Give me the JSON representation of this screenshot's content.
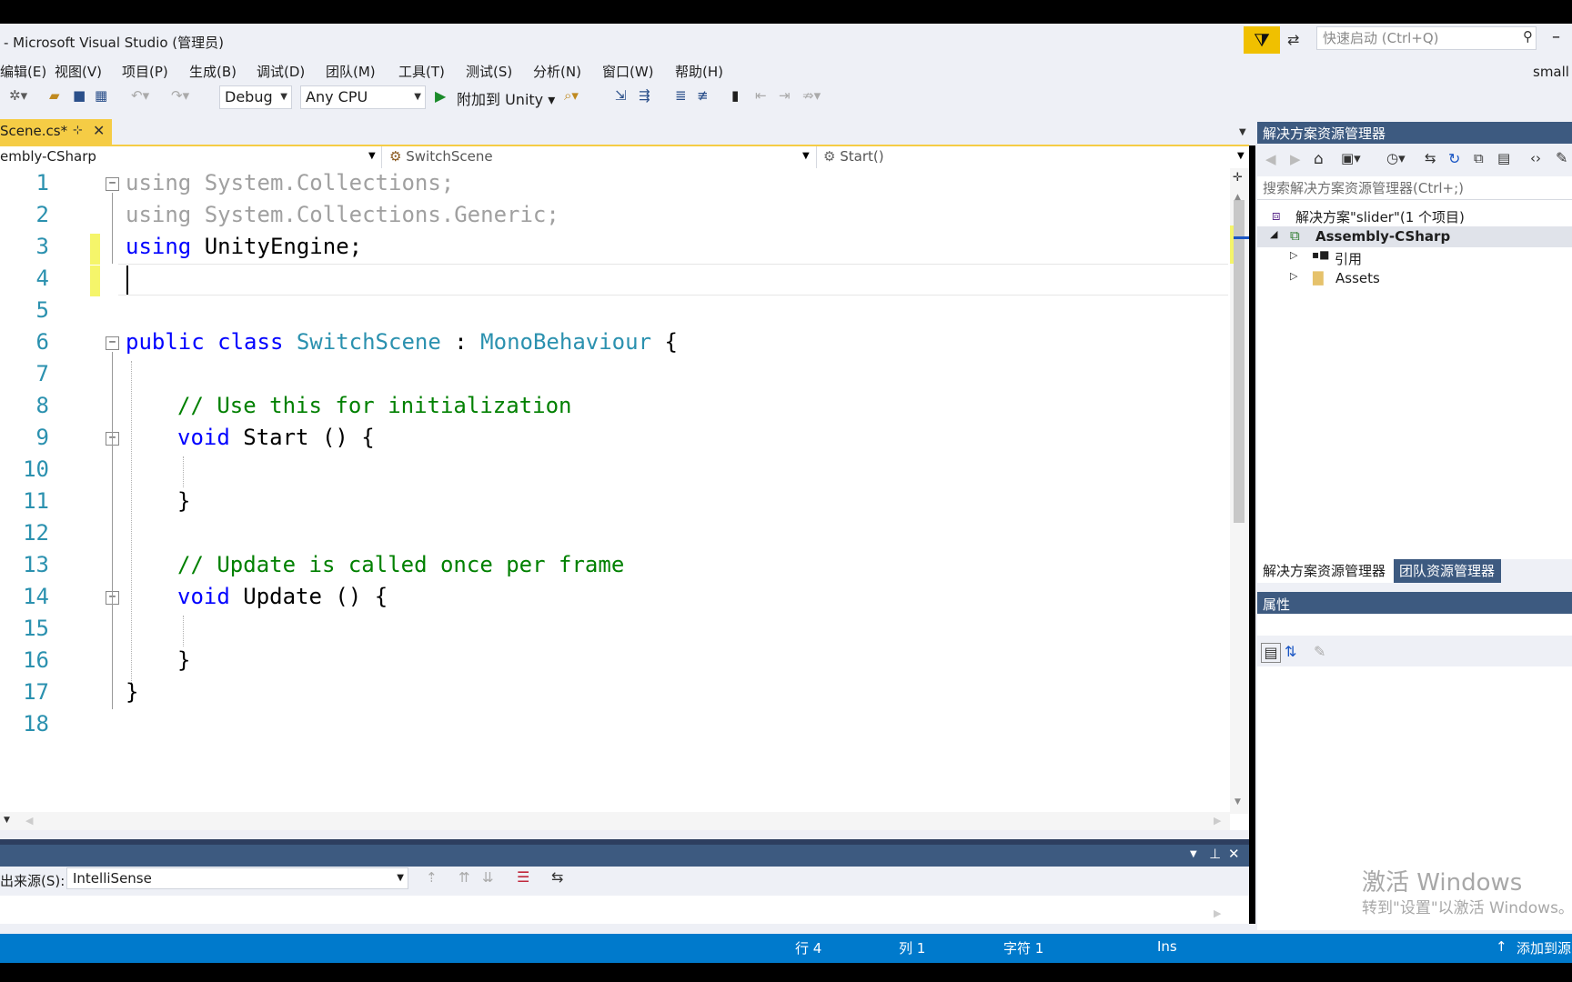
{
  "window": {
    "title": "- Microsoft Visual Studio (管理员)",
    "quick_launch_placeholder": "快速启动 (Ctrl+Q)",
    "user": "small"
  },
  "menu": [
    "编辑(E)",
    "视图(V)",
    "项目(P)",
    "生成(B)",
    "调试(D)",
    "团队(M)",
    "工具(T)",
    "测试(S)",
    "分析(N)",
    "窗口(W)",
    "帮助(H)"
  ],
  "toolbar": {
    "config": "Debug",
    "platform": "Any CPU",
    "attach": "附加到 Unity"
  },
  "tab": {
    "name": "Scene.cs*"
  },
  "nav": {
    "project": "embly-CSharp",
    "class": "SwitchScene",
    "member": "Start()"
  },
  "editor": {
    "line_numbers": [
      "1",
      "2",
      "3",
      "4",
      "5",
      "6",
      "7",
      "8",
      "9",
      "10",
      "11",
      "12",
      "13",
      "14",
      "15",
      "16",
      "17",
      "18"
    ],
    "l1_kw": "using",
    "l1_rest": " System.Collections;",
    "l2_kw": "using",
    "l2_rest": " System.Collections.Generic;",
    "l3_kw": "using",
    "l3_rest": " UnityEngine;",
    "l6_kw1": "public",
    "l6_kw2": " class ",
    "l6_type1": "SwitchScene",
    "l6_colon": " : ",
    "l6_type2": "MonoBehaviour",
    "l6_brace": " {",
    "l8_comment": "// Use this for initialization",
    "l9_kw": "void",
    "l9_rest": " Start () {",
    "l11": "}",
    "l13_comment": "// Update is called once per frame",
    "l14_kw": "void",
    "l14_rest": " Update () {",
    "l16": "}",
    "l17": "}"
  },
  "output": {
    "source_label": "出来源(S):",
    "source_value": "IntelliSense"
  },
  "status": {
    "row": "行 4",
    "col": "列 1",
    "char": "字符 1",
    "mode": "Ins",
    "source_control": "添加到源"
  },
  "solution_explorer": {
    "title": "解决方案资源管理器",
    "search_placeholder": "搜索解决方案资源管理器(Ctrl+;)",
    "solution": "解决方案\"slider\"(1 个项目)",
    "project": "Assembly-CSharp",
    "references": "引用",
    "assets": "Assets",
    "tab_solution": "解决方案资源管理器",
    "tab_team": "团队资源管理器"
  },
  "properties": {
    "title": "属性"
  },
  "watermark": {
    "line1": "激活 Windows",
    "line2": "转到\"设置\"以激活 Windows。"
  }
}
